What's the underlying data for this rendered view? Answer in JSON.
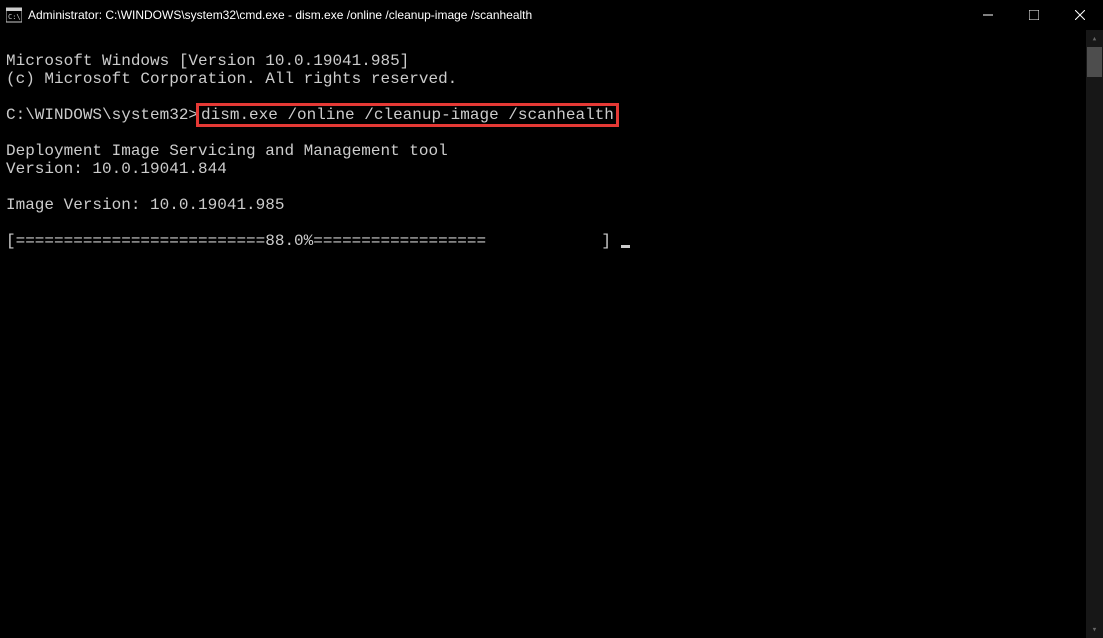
{
  "titlebar": {
    "title": "Administrator: C:\\WINDOWS\\system32\\cmd.exe - dism.exe  /online /cleanup-image /scanhealth"
  },
  "terminal": {
    "line1": "Microsoft Windows [Version 10.0.19041.985]",
    "line2": "(c) Microsoft Corporation. All rights reserved.",
    "prompt_path": "C:\\WINDOWS\\system32>",
    "command": "dism.exe /online /cleanup-image /scanhealth",
    "tool_name": "Deployment Image Servicing and Management tool",
    "tool_version": "Version: 10.0.19041.844",
    "image_version": "Image Version: 10.0.19041.985",
    "progress_left": "[==========================",
    "progress_pct": "88.0%",
    "progress_right": "==================            ] "
  }
}
